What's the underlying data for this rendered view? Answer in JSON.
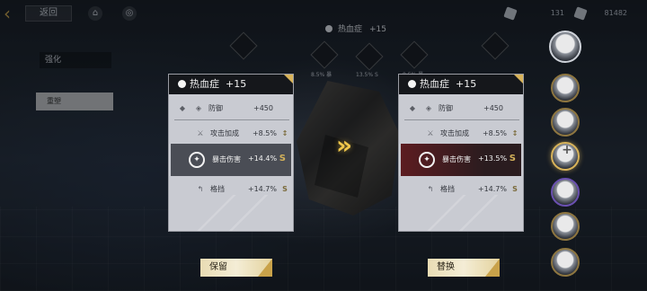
{
  "topbar": {
    "back_label": "返回",
    "resource_1": "131",
    "resource_2": "81482"
  },
  "side": {
    "label_1": "强化",
    "label_2": "重塑"
  },
  "center_header": {
    "name": "热血症",
    "level": "+15"
  },
  "hex_labels": [
    "8.5% 暴",
    "13.5% S",
    "8.5% 暴"
  ],
  "left_card": {
    "title": "热血症",
    "level": "+15",
    "stats": [
      {
        "name": "防御",
        "value": "+450"
      },
      {
        "name": "攻击加成",
        "value": "+8.5%"
      },
      {
        "name": "暴击伤害",
        "value": "+14.4%",
        "mark": "S"
      },
      {
        "name": "格挡",
        "value": "+14.7%"
      }
    ]
  },
  "right_card": {
    "title": "热血症",
    "level": "+15",
    "stats": [
      {
        "name": "防御",
        "value": "+450"
      },
      {
        "name": "攻击加成",
        "value": "+8.5%"
      },
      {
        "name": "暴击伤害",
        "value": "+13.5%",
        "mark": "S"
      },
      {
        "name": "格挡",
        "value": "+14.7%"
      }
    ]
  },
  "buttons": {
    "keep": "保留",
    "replace": "替换"
  },
  "colors": {
    "accent_gold": "#d8b35a",
    "highlight_red": "#5c1c20",
    "card_bg": "#c9cbd2"
  },
  "icons": [
    "back-arrow-icon",
    "home-icon",
    "settings-icon",
    "gem-icon",
    "ticket-icon",
    "shield-icon",
    "sword-icon",
    "crit-icon",
    "block-icon",
    "double-chevron-icon"
  ]
}
